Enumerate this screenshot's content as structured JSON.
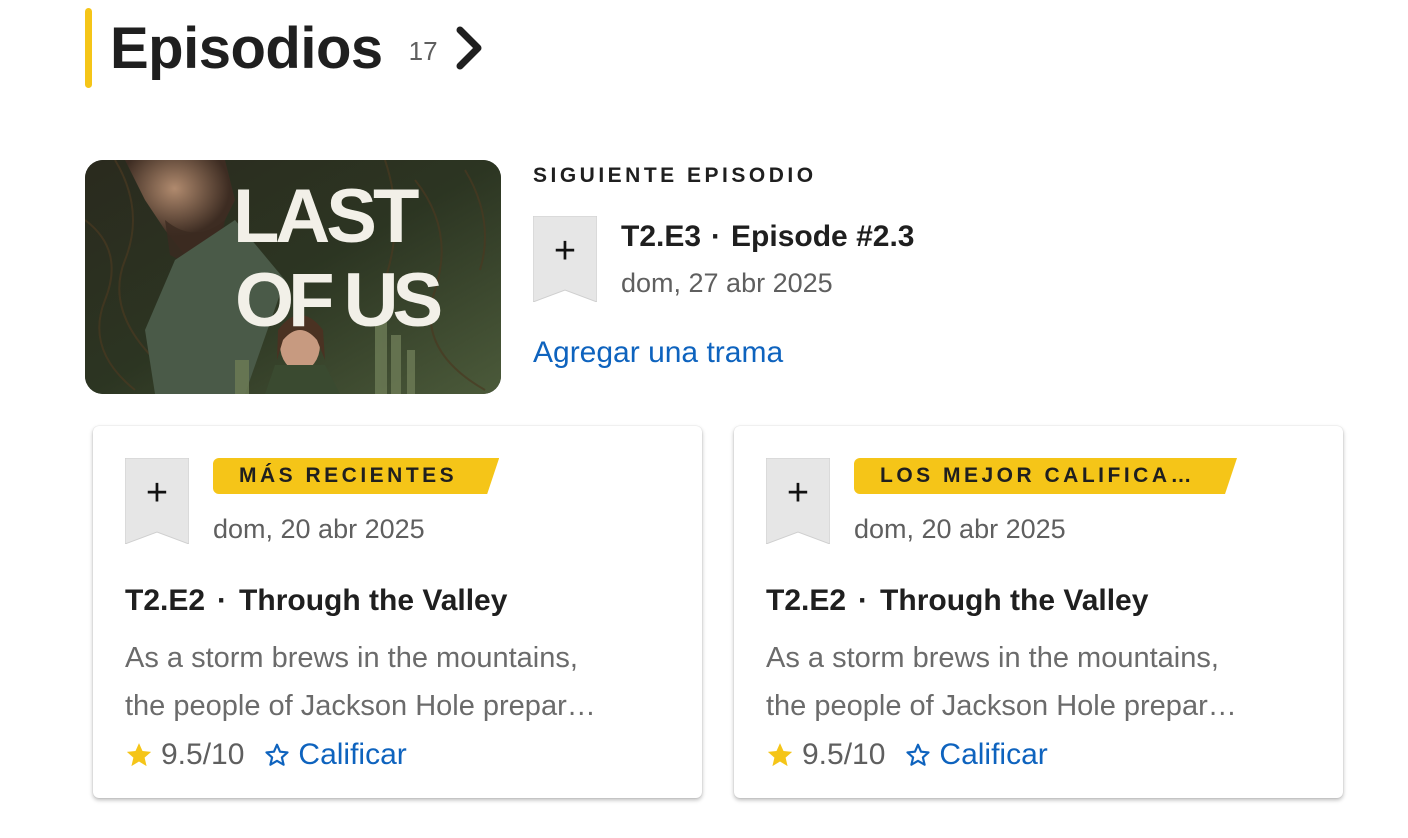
{
  "header": {
    "title": "Episodios",
    "count": "17"
  },
  "next_episode": {
    "kicker": "SIGUIENTE EPISODIO",
    "code": "T2.E3",
    "separator": "·",
    "title": "Episode #2.3",
    "date": "dom, 27 abr 2025",
    "add_plot": "Agregar una trama",
    "poster_text_line1": "LAST",
    "poster_text_line2": "OF US"
  },
  "cards": [
    {
      "badge": "MÁS RECIENTES",
      "date": "dom, 20 abr 2025",
      "code": "T2.E2",
      "separator": "·",
      "title": "Through the Valley",
      "desc_line1": "As a storm brews in the mountains,",
      "desc_line2": "the people of Jackson Hole prepar…",
      "rating": "9.5/10",
      "rate_label": "Calificar"
    },
    {
      "badge": "LOS MEJOR CALIFICA…",
      "date": "dom, 20 abr 2025",
      "code": "T2.E2",
      "separator": "·",
      "title": "Through the Valley",
      "desc_line1": "As a storm brews in the mountains,",
      "desc_line2": "the people of Jackson Hole prepar…",
      "rating": "9.5/10",
      "rate_label": "Calificar"
    }
  ],
  "colors": {
    "accent": "#f5c518",
    "link": "#0e63be",
    "text": "#1f1f1f",
    "muted": "#5f5f5f"
  },
  "icons": {
    "header_chevron": "chevron-right-icon",
    "watchlist": "plus-icon",
    "rating": "star-filled-icon",
    "rate": "star-outline-icon"
  }
}
